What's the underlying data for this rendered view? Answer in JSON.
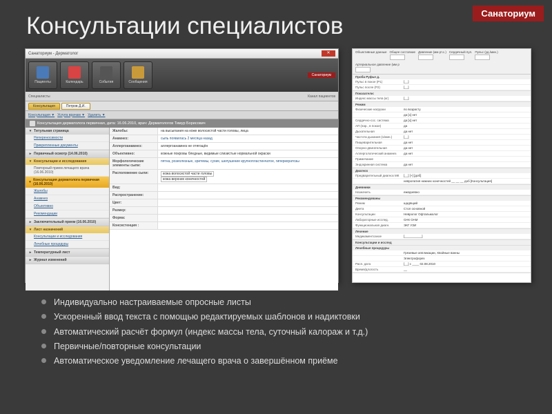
{
  "badge": "Санаториум",
  "title": "Консультации специалистов",
  "win1": {
    "titlebar": "Санаториум - Дерматолог",
    "toolbar": [
      {
        "label": "Пациенты"
      },
      {
        "label": "Календарь"
      },
      {
        "label": "События"
      },
      {
        "label": "Сообщения"
      }
    ],
    "brand": "Санаториум",
    "search_left": "Специалисты",
    "search_right": "Канал пациентов",
    "tabs": [
      {
        "label": "Консультация"
      },
      {
        "label": "Петров Д.И."
      }
    ],
    "subtabs": [
      "Консультация ▼",
      "Услуга врачам ▼",
      "Удалить ▼"
    ],
    "form_title": "Консультация дерматолога первичная, дата: 16.06.2010, врач: Дерматологов Тимур Борисович",
    "sidebar": {
      "group1": {
        "title": "Титульная страница",
        "items": [
          "Непереносимости",
          "Прикрепленные документы"
        ]
      },
      "group2": {
        "title": "Первичный осмотр (14.06.2010)"
      },
      "group3": {
        "title": "Консультации и исследования",
        "items": [
          "Повторный прием лечащего врача (16.06.2010)",
          "Консультация дерматолога первичная (16.06.2010)"
        ],
        "sub": [
          "Жалобы",
          "Анамнез",
          "Объективно",
          "Рекомендации"
        ]
      },
      "group4": {
        "title": "Заключительный прием (16.06.2010)"
      },
      "group5": {
        "title": "Лист назначений",
        "items": [
          "Консультации и исследования",
          "Лечебные процедуры"
        ]
      },
      "group6": {
        "title": "Температурный лист"
      },
      "group7": {
        "title": "Журнал изменений"
      }
    },
    "form": {
      "visit_reason": "на высыпания на коже волосистой части головы, лица",
      "complaints_label": "Жалобы:",
      "anamnez_label": "Анамнез:",
      "anamnez_val": "сыпь появилась 2 месяца назад",
      "allergy_label": "Аллергоанамнез:",
      "allergy_val": "аллергоанамнез не отягощён",
      "objective_label": "Объективно:",
      "objective_val": "кожные покровы бледные, видимые слизистые нормальной окраски",
      "morph_label": "Морфологические элементы сыпи:",
      "morph_val": "пятна, розеолезные, эритемы, сухие, шелушение крупнопластинчатое, гиперкератозы",
      "rash_fields": [
        {
          "label": "Расположение сыпи:",
          "items": [
            "кожа волосистой части головы",
            "кожа верхних конечностей"
          ],
          "has_input": true
        },
        {
          "label": "Вид:"
        },
        {
          "label": "Распространение:"
        },
        {
          "label": "Цвет:"
        },
        {
          "label": "Размер:"
        },
        {
          "label": "Форма:"
        },
        {
          "label": "Консистенция :"
        }
      ]
    }
  },
  "win2": {
    "top_fields": [
      {
        "label": "Объективные данные"
      },
      {
        "label": "Общее состояние",
        "val": ""
      },
      {
        "label": "Давление (мм рт.с.)",
        "val": ""
      },
      {
        "label": "Сердечный пул.",
        "val": ""
      },
      {
        "label": "Пульс (уд./мин.)",
        "val": ""
      },
      {
        "label": "Артериальное давление (мм р"
      }
    ],
    "sections": [
      {
        "head": "Проба Руфье д.",
        "rows": [
          {
            "l": "Пульс в покое (P1)",
            "r": "[__]"
          },
          {
            "l": "Пульс после (P2)",
            "r": "[__]"
          }
        ]
      },
      {
        "head": "Показатели:",
        "rows": [
          {
            "l": "Индекс массы тела (кг)",
            "r": "[__]"
          }
        ]
      },
      {
        "head": "Режим",
        "rows": [
          {
            "l": "Физические нагрузки",
            "r": "по возрасту"
          },
          {
            "l": "",
            "r": "да [x] нет"
          },
          {
            "l": "Сердечно-сос. система",
            "r": "да [x] нет"
          },
          {
            "l": "АП (пар., в покое)",
            "r": "да"
          },
          {
            "l": "Дыхательная",
            "r": "да нет"
          },
          {
            "l": "Частота дыхания (1/мин.)",
            "r": "[__]"
          },
          {
            "l": "Пищеварительная",
            "r": "да нет"
          },
          {
            "l": "Опорно-двигательная",
            "r": "да нет"
          },
          {
            "l": "Аллергологический анамнез",
            "r": "да нет"
          },
          {
            "l": "Примечание",
            "r": ""
          },
          {
            "l": "Эндокринная система",
            "r": "да нет"
          }
        ]
      },
      {
        "head": "Диагноз",
        "rows": [
          {
            "l": "Предварительный диагноз МК",
            "r": "[__] [+] [доб]"
          },
          {
            "l": "",
            "r": "невропатия нижних конечностей __ __ __ доб [Консультация]"
          }
        ]
      },
      {
        "head": "Дневники",
        "rows": [
          {
            "l": "Назначить",
            "r": "ежедневно"
          }
        ]
      },
      {
        "head": "Рекомендованы",
        "rows": [
          {
            "l": "Режим",
            "r": "щадящий"
          },
          {
            "l": "Диета",
            "r": "Стол основной"
          },
          {
            "l": "Консультации",
            "r": "Невролог Офтальмолог"
          },
          {
            "l": "Лабораторные исслед.",
            "r": "ОАК ОАМ"
          },
          {
            "l": "Функциональная диагн.",
            "r": "ЭКГ УЗИ"
          }
        ]
      },
      {
        "head": "Лечение",
        "rows": [
          {
            "l": "Медикаментозное",
            "r": "[__________]"
          }
        ]
      },
      {
        "head": "Консультации и исслед",
        "rows": []
      },
      {
        "head": "Лечебные процедуры",
        "rows": [
          {
            "l": "",
            "r": "Грязевые аппликации, Хвойные ванны"
          },
          {
            "l": "",
            "r": "Электрофорез"
          },
          {
            "l": "Расп. дата",
            "r": "[__] с ____ 02.08.2010"
          },
          {
            "l": "Время/длогость",
            "r": "__"
          }
        ]
      }
    ]
  },
  "bullets": [
    "Индивидуально настраиваемые опросные листы",
    "Ускоренный ввод текста с помощью редактируемых шаблонов и надиктовки",
    "Автоматический расчёт формул (индекс массы тела, суточный калораж и т.д.)",
    "Первичные/повторные консультации",
    "Автоматическое уведомление лечащего врача о завершённом приёме"
  ]
}
